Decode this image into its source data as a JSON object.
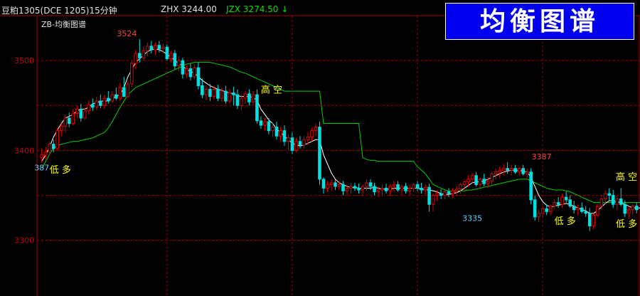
{
  "header": {
    "symbol": "豆粕1305(DCE 1205)15分钟",
    "zhx": "ZHX 3244.00",
    "jzx": "JZX 3274.50 ↓"
  },
  "banner": {
    "text": "均衡图谱"
  },
  "indicator": {
    "label": "ZB-均衡图谱"
  },
  "colors": {
    "background": "#000000",
    "grid": "#a00000",
    "axis_text": "#c80000",
    "up": "#e00000",
    "down": "#00e0e0",
    "white_line": "#ffffff",
    "green_line": "#00d000",
    "signal_text": "#ffff00",
    "high_label": "#ff4040",
    "low_label": "#60d0ff",
    "banner_bg": "#0000ee"
  },
  "chart_data": {
    "type": "candlestick",
    "ylim": [
      3238,
      3550
    ],
    "y_ticks": [
      3300,
      3400,
      3500
    ],
    "price_labels": [
      {
        "text": "3524",
        "index": 25,
        "value": 3524,
        "kind": "high"
      },
      {
        "text": "3387",
        "index": 131,
        "value": 3387,
        "kind": "high"
      },
      {
        "text": "3335",
        "index": 110,
        "value": 3332,
        "kind": "low"
      },
      {
        "text": "387",
        "index": 0,
        "value": 3388,
        "kind": "low"
      }
    ],
    "signals": [
      {
        "text": "低 多",
        "index": 2,
        "value": 3375
      },
      {
        "text": "高 空",
        "index": 56,
        "value": 3464
      },
      {
        "text": "低 多",
        "index": 131,
        "value": 3318
      },
      {
        "text": "高 空",
        "index": 170,
        "value": 3367
      },
      {
        "text": "低 多",
        "index": 166,
        "value": 3315
      }
    ],
    "candles": [],
    "ohlc": [
      [
        3392,
        3402,
        3386,
        3395
      ],
      [
        3395,
        3404,
        3390,
        3398
      ],
      [
        3398,
        3410,
        3395,
        3407
      ],
      [
        3407,
        3412,
        3398,
        3402
      ],
      [
        3402,
        3425,
        3400,
        3422
      ],
      [
        3422,
        3430,
        3416,
        3427
      ],
      [
        3427,
        3440,
        3420,
        3436
      ],
      [
        3436,
        3442,
        3426,
        3430
      ],
      [
        3430,
        3446,
        3428,
        3441
      ],
      [
        3441,
        3450,
        3436,
        3446
      ],
      [
        3446,
        3452,
        3432,
        3436
      ],
      [
        3436,
        3448,
        3434,
        3444
      ],
      [
        3444,
        3456,
        3440,
        3451
      ],
      [
        3451,
        3458,
        3444,
        3448
      ],
      [
        3448,
        3460,
        3445,
        3455
      ],
      [
        3455,
        3462,
        3447,
        3450
      ],
      [
        3450,
        3462,
        3446,
        3458
      ],
      [
        3458,
        3466,
        3452,
        3455
      ],
      [
        3455,
        3466,
        3453,
        3462
      ],
      [
        3462,
        3470,
        3456,
        3458
      ],
      [
        3458,
        3475,
        3455,
        3470
      ],
      [
        3470,
        3482,
        3466,
        3460
      ],
      [
        3460,
        3478,
        3458,
        3474
      ],
      [
        3474,
        3500,
        3470,
        3497
      ],
      [
        3497,
        3512,
        3490,
        3508
      ],
      [
        3508,
        3524,
        3498,
        3503
      ],
      [
        3503,
        3516,
        3500,
        3511
      ],
      [
        3511,
        3520,
        3505,
        3516
      ],
      [
        3516,
        3522,
        3508,
        3512
      ],
      [
        3512,
        3520,
        3506,
        3517
      ],
      [
        3517,
        3522,
        3509,
        3513
      ],
      [
        3513,
        3519,
        3508,
        3515
      ],
      [
        3515,
        3518,
        3500,
        3502
      ],
      [
        3502,
        3511,
        3498,
        3508
      ],
      [
        3508,
        3512,
        3490,
        3494
      ],
      [
        3494,
        3505,
        3488,
        3500
      ],
      [
        3500,
        3503,
        3480,
        3485
      ],
      [
        3485,
        3495,
        3481,
        3491
      ],
      [
        3491,
        3497,
        3478,
        3482
      ],
      [
        3482,
        3496,
        3479,
        3492
      ],
      [
        3492,
        3498,
        3468,
        3472
      ],
      [
        3472,
        3480,
        3458,
        3462
      ],
      [
        3462,
        3472,
        3456,
        3468
      ],
      [
        3468,
        3474,
        3455,
        3460
      ],
      [
        3460,
        3472,
        3457,
        3468
      ],
      [
        3468,
        3473,
        3455,
        3458
      ],
      [
        3458,
        3470,
        3454,
        3466
      ],
      [
        3466,
        3472,
        3452,
        3455
      ],
      [
        3455,
        3468,
        3452,
        3464
      ],
      [
        3464,
        3471,
        3450,
        3462
      ],
      [
        3462,
        3468,
        3446,
        3450
      ],
      [
        3450,
        3462,
        3445,
        3458
      ],
      [
        3458,
        3466,
        3452,
        3463
      ],
      [
        3463,
        3468,
        3450,
        3454
      ],
      [
        3454,
        3466,
        3450,
        3462
      ],
      [
        3462,
        3468,
        3430,
        3433
      ],
      [
        3433,
        3438,
        3424,
        3428
      ],
      [
        3428,
        3436,
        3422,
        3432
      ],
      [
        3432,
        3436,
        3418,
        3422
      ],
      [
        3422,
        3430,
        3415,
        3426
      ],
      [
        3426,
        3432,
        3412,
        3416
      ],
      [
        3416,
        3426,
        3410,
        3422
      ],
      [
        3422,
        3428,
        3405,
        3410
      ],
      [
        3410,
        3418,
        3400,
        3414
      ],
      [
        3414,
        3420,
        3396,
        3400
      ],
      [
        3400,
        3414,
        3398,
        3410
      ],
      [
        3410,
        3416,
        3402,
        3406
      ],
      [
        3406,
        3416,
        3402,
        3412
      ],
      [
        3412,
        3420,
        3406,
        3415
      ],
      [
        3415,
        3425,
        3410,
        3422
      ],
      [
        3422,
        3430,
        3416,
        3426
      ],
      [
        3426,
        3432,
        3362,
        3368
      ],
      [
        3368,
        3370,
        3352,
        3358
      ],
      [
        3358,
        3366,
        3354,
        3362
      ],
      [
        3362,
        3368,
        3355,
        3364
      ],
      [
        3364,
        3368,
        3356,
        3360
      ],
      [
        3360,
        3366,
        3356,
        3362
      ],
      [
        3362,
        3366,
        3350,
        3355
      ],
      [
        3355,
        3362,
        3350,
        3358
      ],
      [
        3358,
        3364,
        3352,
        3360
      ],
      [
        3360,
        3364,
        3355,
        3358
      ],
      [
        3358,
        3363,
        3352,
        3356
      ],
      [
        3356,
        3362,
        3350,
        3360
      ],
      [
        3360,
        3368,
        3355,
        3364
      ],
      [
        3364,
        3368,
        3356,
        3360
      ],
      [
        3360,
        3364,
        3350,
        3354
      ],
      [
        3354,
        3360,
        3348,
        3356
      ],
      [
        3356,
        3362,
        3350,
        3358
      ],
      [
        3358,
        3363,
        3352,
        3355
      ],
      [
        3355,
        3362,
        3350,
        3360
      ],
      [
        3360,
        3366,
        3354,
        3362
      ],
      [
        3362,
        3366,
        3354,
        3356
      ],
      [
        3356,
        3362,
        3350,
        3360
      ],
      [
        3360,
        3364,
        3352,
        3355
      ],
      [
        3355,
        3362,
        3350,
        3358
      ],
      [
        3358,
        3364,
        3354,
        3362
      ],
      [
        3362,
        3366,
        3355,
        3358
      ],
      [
        3358,
        3364,
        3352,
        3356
      ],
      [
        3356,
        3362,
        3350,
        3359
      ],
      [
        3359,
        3363,
        3332,
        3340
      ],
      [
        3340,
        3352,
        3332,
        3350
      ],
      [
        3350,
        3356,
        3344,
        3352
      ],
      [
        3352,
        3357,
        3346,
        3350
      ],
      [
        3350,
        3356,
        3346,
        3354
      ],
      [
        3354,
        3358,
        3348,
        3352
      ],
      [
        3352,
        3358,
        3347,
        3355
      ],
      [
        3355,
        3360,
        3350,
        3357
      ],
      [
        3357,
        3364,
        3352,
        3362
      ],
      [
        3362,
        3368,
        3356,
        3365
      ],
      [
        3365,
        3372,
        3360,
        3368
      ],
      [
        3368,
        3375,
        3364,
        3372
      ],
      [
        3372,
        3376,
        3360,
        3362
      ],
      [
        3362,
        3370,
        3358,
        3368
      ],
      [
        3368,
        3374,
        3360,
        3363
      ],
      [
        3363,
        3370,
        3358,
        3366
      ],
      [
        3366,
        3376,
        3362,
        3374
      ],
      [
        3374,
        3380,
        3368,
        3376
      ],
      [
        3376,
        3382,
        3370,
        3378
      ],
      [
        3378,
        3385,
        3372,
        3380
      ],
      [
        3380,
        3387,
        3374,
        3378
      ],
      [
        3378,
        3384,
        3372,
        3380
      ],
      [
        3380,
        3384,
        3374,
        3376
      ],
      [
        3376,
        3382,
        3372,
        3380
      ],
      [
        3380,
        3384,
        3372,
        3374
      ],
      [
        3374,
        3380,
        3368,
        3376
      ],
      [
        3376,
        3380,
        3340,
        3345
      ],
      [
        3345,
        3350,
        3322,
        3326
      ],
      [
        3326,
        3334,
        3320,
        3330
      ],
      [
        3330,
        3338,
        3326,
        3335
      ],
      [
        3335,
        3340,
        3328,
        3332
      ],
      [
        3332,
        3340,
        3328,
        3338
      ],
      [
        3338,
        3346,
        3334,
        3342
      ],
      [
        3342,
        3348,
        3336,
        3340
      ],
      [
        3340,
        3352,
        3336,
        3348
      ],
      [
        3348,
        3354,
        3342,
        3345
      ],
      [
        3345,
        3350,
        3336,
        3338
      ],
      [
        3338,
        3344,
        3330,
        3334
      ],
      [
        3334,
        3340,
        3328,
        3336
      ],
      [
        3336,
        3342,
        3330,
        3332
      ],
      [
        3332,
        3338,
        3326,
        3330
      ],
      [
        3330,
        3336,
        3310,
        3316
      ],
      [
        3316,
        3330,
        3312,
        3328
      ],
      [
        3328,
        3340,
        3326,
        3338
      ],
      [
        3338,
        3350,
        3334,
        3346
      ],
      [
        3346,
        3356,
        3340,
        3352
      ],
      [
        3352,
        3358,
        3344,
        3350
      ],
      [
        3350,
        3356,
        3336,
        3340
      ],
      [
        3340,
        3350,
        3334,
        3346
      ],
      [
        3346,
        3358,
        3338,
        3340
      ],
      [
        3340,
        3344,
        3326,
        3330
      ],
      [
        3330,
        3338,
        3324,
        3334
      ],
      [
        3334,
        3340,
        3328,
        3338
      ],
      [
        3338,
        3342,
        3330,
        3334
      ]
    ],
    "white_line": [
      3388,
      3395,
      3404,
      3415,
      3423,
      3430,
      3436,
      3438,
      3440,
      3444,
      3446,
      3446,
      3448,
      3452,
      3453,
      3455,
      3455,
      3455,
      3458,
      3460,
      3462,
      3470,
      3482,
      3490,
      3498,
      3502,
      3506,
      3510,
      3512,
      3513,
      3512,
      3510,
      3507,
      3504,
      3500,
      3497,
      3494,
      3490,
      3488,
      3486,
      3482,
      3478,
      3475,
      3472,
      3470,
      3468,
      3467,
      3465,
      3464,
      3463,
      3461,
      3460,
      3460,
      3460,
      3459,
      3456,
      3446,
      3440,
      3434,
      3430,
      3424,
      3420,
      3416,
      3412,
      3408,
      3406,
      3405,
      3406,
      3408,
      3410,
      3412,
      3412,
      3395,
      3385,
      3375,
      3368,
      3364,
      3362,
      3360,
      3359,
      3359,
      3358,
      3358,
      3358,
      3358,
      3359,
      3358,
      3357,
      3357,
      3357,
      3358,
      3358,
      3358,
      3358,
      3358,
      3358,
      3358,
      3357,
      3356,
      3356,
      3355,
      3354,
      3352,
      3351,
      3351,
      3352,
      3353,
      3355,
      3358,
      3361,
      3364,
      3365,
      3365,
      3366,
      3368,
      3370,
      3372,
      3374,
      3376,
      3377,
      3378,
      3378,
      3378,
      3377,
      3376,
      3370,
      3360,
      3350,
      3343,
      3339,
      3337,
      3338,
      3339,
      3340,
      3341,
      3340,
      3338,
      3336,
      3334,
      3333,
      3330,
      3330,
      3333,
      3337,
      3341,
      3344,
      3344,
      3343,
      3342,
      3340,
      3338,
      3336,
      3336,
      3336
    ],
    "green_line": [
      3380,
      3388,
      3396,
      3402,
      3405,
      3407,
      3408,
      3409,
      3410,
      3410,
      3411,
      3412,
      3413,
      3414,
      3416,
      3418,
      3420,
      3425,
      3432,
      3440,
      3448,
      3455,
      3462,
      3466,
      3470,
      3472,
      3474,
      3476,
      3478,
      3480,
      3482,
      3484,
      3486,
      3488,
      3490,
      3492,
      3494,
      3496,
      3497,
      3498,
      3498,
      3498,
      3498,
      3498,
      3497,
      3496,
      3495,
      3494,
      3493,
      3491,
      3489,
      3487,
      3486,
      3484,
      3482,
      3480,
      3478,
      3476,
      3474,
      3472,
      3470,
      3468,
      3466,
      3466,
      3466,
      3466,
      3466,
      3466,
      3466,
      3466,
      3466,
      3466,
      3430,
      3430,
      3430,
      3430,
      3430,
      3430,
      3430,
      3430,
      3430,
      3430,
      3392,
      3390,
      3389,
      3389,
      3388,
      3388,
      3388,
      3388,
      3388,
      3388,
      3388,
      3388,
      3388,
      3388,
      3382,
      3378,
      3374,
      3368,
      3362,
      3360,
      3358,
      3356,
      3355,
      3355,
      3355,
      3355,
      3355,
      3356,
      3356,
      3357,
      3358,
      3359,
      3360,
      3361,
      3362,
      3363,
      3364,
      3365,
      3366,
      3367,
      3368,
      3368,
      3368,
      3366,
      3364,
      3362,
      3360,
      3358,
      3357,
      3356,
      3356,
      3356,
      3355,
      3354,
      3352,
      3350,
      3348,
      3346,
      3344,
      3342,
      3342,
      3342,
      3342,
      3342,
      3342,
      3342,
      3342,
      3342,
      3342,
      3342,
      3342,
      3342,
      3342
    ]
  }
}
